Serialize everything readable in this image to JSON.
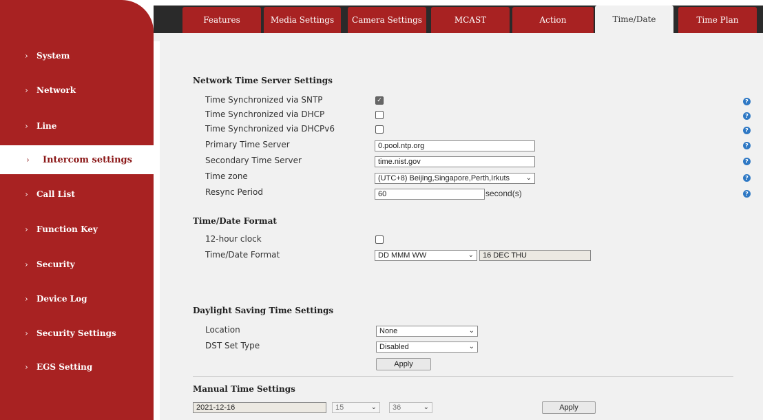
{
  "sidebar": {
    "items": [
      {
        "label": "System"
      },
      {
        "label": "Network"
      },
      {
        "label": "Line"
      },
      {
        "label": "Intercom settings"
      },
      {
        "label": "Call List"
      },
      {
        "label": "Function Key"
      },
      {
        "label": "Security"
      },
      {
        "label": "Device Log"
      },
      {
        "label": "Security Settings"
      },
      {
        "label": "EGS Setting"
      }
    ],
    "chevron": "›",
    "active_index": 3
  },
  "tabs": [
    {
      "label": "Features"
    },
    {
      "label": "Media Settings"
    },
    {
      "label": "Camera Settings"
    },
    {
      "label": "MCAST"
    },
    {
      "label": "Action"
    },
    {
      "label": "Time/Date"
    },
    {
      "label": "Time Plan"
    }
  ],
  "ntp": {
    "title": "Network Time Server Settings",
    "sntp_label": "Time Synchronized via SNTP",
    "sntp_checked": true,
    "dhcp_label": "Time Synchronized via DHCP",
    "dhcp_checked": false,
    "dhcpv6_label": "Time Synchronized via DHCPv6",
    "dhcpv6_checked": false,
    "primary_label": "Primary Time Server",
    "primary_value": "0.pool.ntp.org",
    "secondary_label": "Secondary Time Server",
    "secondary_value": "time.nist.gov",
    "timezone_label": "Time zone",
    "timezone_value": "(UTC+8) Beijing,Singapore,Perth,Irkuts",
    "resync_label": "Resync Period",
    "resync_value": "60",
    "resync_unit": "second(s)"
  },
  "format": {
    "title": "Time/Date Format",
    "clock12_label": "12-hour clock",
    "clock12_checked": false,
    "format_label": "Time/Date Format",
    "format_value": "DD MMM WW",
    "format_preview": "16 DEC THU"
  },
  "dst": {
    "title": "Daylight Saving Time Settings",
    "location_label": "Location",
    "location_value": "None",
    "type_label": "DST Set Type",
    "type_value": "Disabled",
    "apply_label": "Apply"
  },
  "manual": {
    "title": "Manual Time Settings",
    "date_value": "2021-12-16",
    "hour_value": "15",
    "minute_value": "36",
    "apply_label": "Apply"
  },
  "icons": {
    "help": "?",
    "check": "✓",
    "dropdown": "⌄"
  },
  "colors": {
    "sidebar_bg": "#a82222",
    "tab_bg": "#a82222",
    "content_bg": "#f1f1f1",
    "help_icon": "#2e78c4"
  }
}
